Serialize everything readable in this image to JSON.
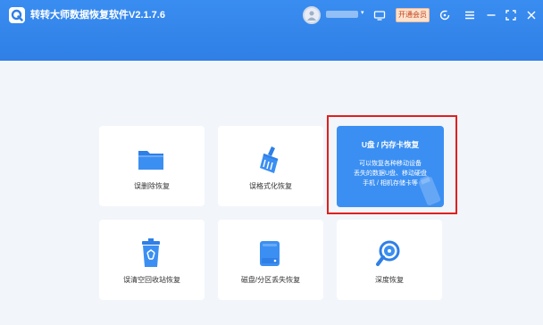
{
  "titlebar": {
    "app_title": "转转大师数据恢复软件V2.1.7.6",
    "vip_label": "开通会员",
    "user_caret": "▾",
    "icons": [
      "app-logo-icon",
      "avatar-icon",
      "monitor-icon",
      "support-icon",
      "menu-icon",
      "minimize-icon",
      "maximize-icon",
      "close-icon"
    ]
  },
  "cards": [
    {
      "label": "误删除恢复",
      "icon": "folder-icon"
    },
    {
      "label": "误格式化恢复",
      "icon": "broom-icon"
    },
    {
      "title": "U盘 / 内存卡恢复",
      "desc": [
        "可以恢复各种移动设备",
        "丢失的数据U盘、移动硬盘",
        "手机 / 相机存储卡等"
      ],
      "selected": true
    },
    {
      "label": "误清空回收站恢复",
      "icon": "recycle-bin-icon"
    },
    {
      "label": "磁盘/分区丢失恢复",
      "icon": "disk-icon"
    },
    {
      "label": "深度恢复",
      "icon": "deep-scan-icon"
    }
  ],
  "colors": {
    "titlebar": "#2f7fe6",
    "accent": "#3b8ff2",
    "highlight": "#e02020",
    "background": "#f2f5fa"
  }
}
